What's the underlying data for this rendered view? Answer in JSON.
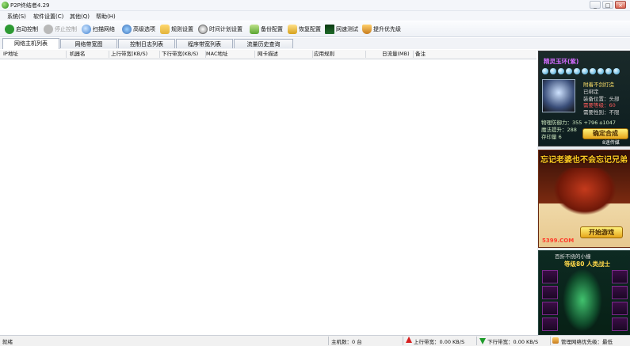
{
  "window": {
    "title": "P2P终结者4.29",
    "buttons": {
      "minimize": "_",
      "maximize": "□",
      "close": "×"
    }
  },
  "menu": {
    "items": [
      "系统(S)",
      "软件设置(C)",
      "其他(Q)",
      "帮助(H)"
    ]
  },
  "toolbar": {
    "buttons": [
      {
        "label": "启动控制",
        "icon": "play-check-icon",
        "color": "#2e9a34",
        "enabled": true
      },
      {
        "label": "停止控制",
        "icon": "stop-icon",
        "color": "#b9b9b9",
        "enabled": false
      },
      {
        "label": "扫描网络",
        "icon": "magnifier-icon",
        "color": "#3c7fd1",
        "enabled": true
      },
      {
        "label": "高级选项",
        "icon": "network-icon",
        "color": "#3a6fb8",
        "enabled": true
      },
      {
        "label": "规则设置",
        "icon": "folder-icon",
        "color": "#e2b33b",
        "enabled": true
      },
      {
        "label": "时间计划设置",
        "icon": "clock-icon",
        "color": "#8d8d8d",
        "enabled": true
      },
      {
        "label": "备份配置",
        "icon": "backup-icon",
        "color": "#5aa532",
        "enabled": true
      },
      {
        "label": "恢复配置",
        "icon": "restore-icon",
        "color": "#d6a21e",
        "enabled": true
      },
      {
        "label": "网速测试",
        "icon": "speed-monitor-icon",
        "color": "#1f6b2a",
        "enabled": true
      },
      {
        "label": "提升优先级",
        "icon": "shield-icon",
        "color": "#c77b1d",
        "enabled": true
      }
    ]
  },
  "tabs": [
    "网络主机列表",
    "网络带宽图",
    "控制日志列表",
    "程序带宽列表",
    "流量历史查询"
  ],
  "table": {
    "columns": [
      "IP地址",
      "机器名",
      "上行带宽(KB/S)",
      "下行带宽(KB/S)",
      "MAC地址",
      "网卡描述",
      "应用规则",
      "日流量(MB)",
      "备注"
    ]
  },
  "ads": {
    "ad1": {
      "title": "精灵玉环(紫)",
      "lines": [
        "附着不剑打造",
        "已绑定",
        "装备位置：头部",
        "需要等级：60",
        "需要性别：不限"
      ],
      "stats": [
        "物理防御力：355 +796 ⌂1047",
        "魔法提升：288",
        "存印量 6"
      ],
      "cta": "确定合成",
      "footer": "8迷传媒"
    },
    "ad2": {
      "title": "忘记老婆也不会忘记兄弟",
      "cta": "开始游戏",
      "site": "5399.COM"
    },
    "ad3": {
      "title": "百折不挠的小撞",
      "subtitle": "等级80 人类战士"
    }
  },
  "status": {
    "ready": "就绪",
    "hosts": "主机数：0 台",
    "upload": "上行带宽：0.00 KB/S",
    "download": "下行带宽：0.00 KB/S",
    "priority": "管理网络优先级：最低"
  },
  "colors": {
    "accent": "#2e9a34",
    "upload_arrow": "#d71f1f",
    "download_arrow": "#1e9b2a"
  }
}
